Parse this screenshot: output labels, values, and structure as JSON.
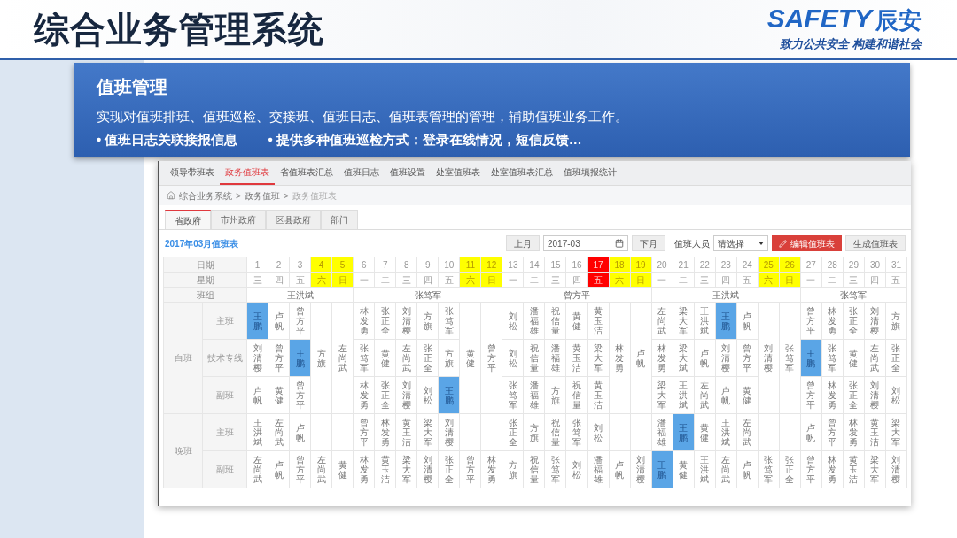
{
  "slide": {
    "title": "综合业务管理系统",
    "logo": {
      "wordmark": "SAFETY",
      "name": "辰安",
      "slogan": "致力公共安全 构建和谐社会"
    }
  },
  "intro": {
    "heading": "值班管理",
    "description": "实现对值班排班、值班巡检、交接班、值班日志、值班表管理的管理，辅助值班业务工作。",
    "bullets": [
      "• 值班日志关联接报信息",
      "• 提供多种值班巡检方式：登录在线情况，短信反馈…"
    ]
  },
  "app": {
    "nav_tabs": [
      {
        "label": "领导带班表",
        "selected": false
      },
      {
        "label": "政务值班表",
        "selected": true
      },
      {
        "label": "省值班表汇总",
        "selected": false
      },
      {
        "label": "值班日志",
        "selected": false
      },
      {
        "label": "值班设置",
        "selected": false
      },
      {
        "label": "处室值班表",
        "selected": false
      },
      {
        "label": "处室值班表汇总",
        "selected": false
      },
      {
        "label": "值班填报统计",
        "selected": false
      }
    ],
    "breadcrumb": [
      "综合业务系统",
      "政务值班",
      "政务值班表"
    ],
    "breadcrumb_separator": ">",
    "sub_tabs": [
      {
        "label": "省政府",
        "selected": true
      },
      {
        "label": "市州政府",
        "selected": false
      },
      {
        "label": "区县政府",
        "selected": false
      },
      {
        "label": "部门",
        "selected": false
      }
    ],
    "table_title": "2017年03月值班表",
    "toolbar": {
      "prev": "上月",
      "month": "2017-03",
      "next": "下月",
      "staff_label": "值班人员",
      "staff_select": "请选择",
      "edit_button": "编辑值班表",
      "generate_button": "生成值班表"
    },
    "schedule": {
      "date_label": "日期",
      "weekday_label": "星期",
      "team_label": "班组",
      "teams": [
        {
          "name": "王洪斌",
          "days": [
            {
              "date": "1",
              "weekday": "三",
              "kind": "workday"
            },
            {
              "date": "2",
              "weekday": "四",
              "kind": "workday"
            },
            {
              "date": "3",
              "weekday": "五",
              "kind": "workday"
            },
            {
              "date": "4",
              "weekday": "六",
              "kind": "weekend"
            },
            {
              "date": "5",
              "weekday": "日",
              "kind": "weekend"
            }
          ]
        },
        {
          "name": "张笃军",
          "days": [
            {
              "date": "6",
              "weekday": "一",
              "kind": "workday"
            },
            {
              "date": "7",
              "weekday": "二",
              "kind": "workday"
            },
            {
              "date": "8",
              "weekday": "三",
              "kind": "workday"
            },
            {
              "date": "9",
              "weekday": "四",
              "kind": "workday"
            },
            {
              "date": "10",
              "weekday": "五",
              "kind": "workday"
            },
            {
              "date": "11",
              "weekday": "六",
              "kind": "weekend"
            },
            {
              "date": "12",
              "weekday": "日",
              "kind": "weekend"
            }
          ]
        },
        {
          "name": "曾方平",
          "days": [
            {
              "date": "13",
              "weekday": "一",
              "kind": "workday"
            },
            {
              "date": "14",
              "weekday": "二",
              "kind": "workday"
            },
            {
              "date": "15",
              "weekday": "三",
              "kind": "workday"
            },
            {
              "date": "16",
              "weekday": "四",
              "kind": "workday"
            },
            {
              "date": "17",
              "weekday": "五",
              "kind": "holiday"
            },
            {
              "date": "18",
              "weekday": "六",
              "kind": "weekend"
            },
            {
              "date": "19",
              "weekday": "日",
              "kind": "weekend"
            }
          ]
        },
        {
          "name": "王洪斌",
          "days": [
            {
              "date": "20",
              "weekday": "一",
              "kind": "workday"
            },
            {
              "date": "21",
              "weekday": "二",
              "kind": "workday"
            },
            {
              "date": "22",
              "weekday": "三",
              "kind": "workday"
            },
            {
              "date": "23",
              "weekday": "四",
              "kind": "workday"
            },
            {
              "date": "24",
              "weekday": "五",
              "kind": "workday"
            },
            {
              "date": "25",
              "weekday": "六",
              "kind": "weekend"
            },
            {
              "date": "26",
              "weekday": "日",
              "kind": "weekend"
            }
          ]
        },
        {
          "name": "张笃军",
          "days": [
            {
              "date": "27",
              "weekday": "一",
              "kind": "workday"
            },
            {
              "date": "28",
              "weekday": "二",
              "kind": "workday"
            },
            {
              "date": "29",
              "weekday": "三",
              "kind": "workday"
            },
            {
              "date": "30",
              "weekday": "四",
              "kind": "workday"
            },
            {
              "date": "31",
              "weekday": "五",
              "kind": "workday"
            }
          ]
        }
      ],
      "shifts": [
        {
          "name": "白班",
          "roles": [
            {
              "name": "主班",
              "cells": [
                {
                  "kind": "single",
                  "name": "王鹏",
                  "highlighted": true
                },
                {
                  "kind": "single",
                  "name": "卢帆",
                  "highlighted": false
                },
                {
                  "kind": "single",
                  "name": "曾方平",
                  "highlighted": false
                },
                {
                  "kind": "merged",
                  "name": "方旗",
                  "highlighted": false
                },
                {
                  "kind": "merged",
                  "name": "左尚武",
                  "highlighted": false
                },
                {
                  "kind": "single",
                  "name": "林发勇",
                  "highlighted": false
                },
                {
                  "kind": "single",
                  "name": "张正全",
                  "highlighted": false
                },
                {
                  "kind": "single",
                  "name": "刘清樱",
                  "highlighted": false
                },
                {
                  "kind": "single",
                  "name": "方旗",
                  "highlighted": false
                },
                {
                  "kind": "single",
                  "name": "张笃军",
                  "highlighted": false
                },
                {
                  "kind": "merged",
                  "name": "黄健",
                  "highlighted": false
                },
                {
                  "kind": "merged",
                  "name": "曾方平",
                  "highlighted": false
                },
                {
                  "kind": "single",
                  "name": "刘松",
                  "highlighted": false
                },
                {
                  "kind": "single",
                  "name": "潘福雄",
                  "highlighted": false
                },
                {
                  "kind": "single",
                  "name": "祝信量",
                  "highlighted": false
                },
                {
                  "kind": "single",
                  "name": "黄健",
                  "highlighted": false
                },
                {
                  "kind": "single",
                  "name": "黄玉洁",
                  "highlighted": false
                },
                {
                  "kind": "merged",
                  "name": "林发勇",
                  "highlighted": false
                },
                {
                  "kind": "merged",
                  "name": "卢帆",
                  "highlighted": false
                },
                {
                  "kind": "single",
                  "name": "左尚武",
                  "highlighted": false
                },
                {
                  "kind": "single",
                  "name": "梁大军",
                  "highlighted": false
                },
                {
                  "kind": "single",
                  "name": "王洪斌",
                  "highlighted": false
                },
                {
                  "kind": "single",
                  "name": "王鹏",
                  "highlighted": true
                },
                {
                  "kind": "single",
                  "name": "卢帆",
                  "highlighted": false
                },
                {
                  "kind": "merged",
                  "name": "刘清樱",
                  "highlighted": false
                },
                {
                  "kind": "merged",
                  "name": "张笃军",
                  "highlighted": false
                },
                {
                  "kind": "single",
                  "name": "曾方平",
                  "highlighted": false
                },
                {
                  "kind": "single",
                  "name": "林发勇",
                  "highlighted": false
                },
                {
                  "kind": "single",
                  "name": "张正全",
                  "highlighted": false
                },
                {
                  "kind": "single",
                  "name": "刘清樱",
                  "highlighted": false
                },
                {
                  "kind": "single",
                  "name": "方旗",
                  "highlighted": false
                }
              ]
            },
            {
              "name": "技术专线",
              "cells": [
                {
                  "kind": "single",
                  "name": "刘清樱",
                  "highlighted": false
                },
                {
                  "kind": "single",
                  "name": "曾方平",
                  "highlighted": false
                },
                {
                  "kind": "single",
                  "name": "王鹏",
                  "highlighted": true
                },
                {
                  "kind": "single",
                  "name": "张笃军",
                  "highlighted": false
                },
                {
                  "kind": "single",
                  "name": "黄健",
                  "highlighted": false
                },
                {
                  "kind": "single",
                  "name": "左尚武",
                  "highlighted": false
                },
                {
                  "kind": "single",
                  "name": "张正全",
                  "highlighted": false
                },
                {
                  "kind": "single",
                  "name": "方旗",
                  "highlighted": false
                },
                {
                  "kind": "single",
                  "name": "刘松",
                  "highlighted": false
                },
                {
                  "kind": "single",
                  "name": "祝信量",
                  "highlighted": false
                },
                {
                  "kind": "single",
                  "name": "潘福雄",
                  "highlighted": false
                },
                {
                  "kind": "single",
                  "name": "黄玉洁",
                  "highlighted": false
                },
                {
                  "kind": "single",
                  "name": "梁大军",
                  "highlighted": false
                },
                {
                  "kind": "single",
                  "name": "林发勇",
                  "highlighted": false
                },
                {
                  "kind": "single",
                  "name": "梁大斌",
                  "highlighted": false
                },
                {
                  "kind": "single",
                  "name": "卢帆",
                  "highlighted": false
                },
                {
                  "kind": "single",
                  "name": "刘清樱",
                  "highlighted": false
                },
                {
                  "kind": "single",
                  "name": "曾方平",
                  "highlighted": false
                },
                {
                  "kind": "single",
                  "name": "王鹏",
                  "highlighted": true
                },
                {
                  "kind": "single",
                  "name": "张笃军",
                  "highlighted": false
                },
                {
                  "kind": "single",
                  "name": "黄健",
                  "highlighted": false
                },
                {
                  "kind": "single",
                  "name": "左尚武",
                  "highlighted": false
                },
                {
                  "kind": "single",
                  "name": "张正全",
                  "highlighted": false
                }
              ]
            },
            {
              "name": "副班",
              "cells": [
                {
                  "kind": "single",
                  "name": "卢帆",
                  "highlighted": false
                },
                {
                  "kind": "single",
                  "name": "黄健",
                  "highlighted": false
                },
                {
                  "kind": "single",
                  "name": "曾方平",
                  "highlighted": false
                },
                {
                  "kind": "single",
                  "name": "林发勇",
                  "highlighted": false
                },
                {
                  "kind": "single",
                  "name": "张正全",
                  "highlighted": false
                },
                {
                  "kind": "single",
                  "name": "刘清樱",
                  "highlighted": false
                },
                {
                  "kind": "single",
                  "name": "刘松",
                  "highlighted": false
                },
                {
                  "kind": "single",
                  "name": "王鹏",
                  "highlighted": true
                },
                {
                  "kind": "single",
                  "name": "张笃军",
                  "highlighted": false
                },
                {
                  "kind": "single",
                  "name": "潘福雄",
                  "highlighted": false
                },
                {
                  "kind": "single",
                  "name": "方旗",
                  "highlighted": false
                },
                {
                  "kind": "single",
                  "name": "祝信量",
                  "highlighted": false
                },
                {
                  "kind": "single",
                  "name": "黄玉洁",
                  "highlighted": false
                },
                {
                  "kind": "single",
                  "name": "梁大军",
                  "highlighted": false
                },
                {
                  "kind": "single",
                  "name": "王洪斌",
                  "highlighted": false
                },
                {
                  "kind": "single",
                  "name": "左尚武",
                  "highlighted": false
                },
                {
                  "kind": "single",
                  "name": "卢帆",
                  "highlighted": false
                },
                {
                  "kind": "single",
                  "name": "黄健",
                  "highlighted": false
                },
                {
                  "kind": "single",
                  "name": "曾方平",
                  "highlighted": false
                },
                {
                  "kind": "single",
                  "name": "林发勇",
                  "highlighted": false
                },
                {
                  "kind": "single",
                  "name": "张正全",
                  "highlighted": false
                },
                {
                  "kind": "single",
                  "name": "刘清樱",
                  "highlighted": false
                },
                {
                  "kind": "single",
                  "name": "刘松",
                  "highlighted": false
                }
              ]
            }
          ]
        },
        {
          "name": "晚班",
          "roles": [
            {
              "name": "主班",
              "cells": [
                {
                  "kind": "single",
                  "name": "王洪斌",
                  "highlighted": false
                },
                {
                  "kind": "single",
                  "name": "左尚武",
                  "highlighted": false
                },
                {
                  "kind": "single",
                  "name": "卢帆",
                  "highlighted": false
                },
                {
                  "kind": "empty"
                },
                {
                  "kind": "empty"
                },
                {
                  "kind": "single",
                  "name": "曾方平",
                  "highlighted": false
                },
                {
                  "kind": "single",
                  "name": "林发勇",
                  "highlighted": false
                },
                {
                  "kind": "single",
                  "name": "黄玉洁",
                  "highlighted": false
                },
                {
                  "kind": "single",
                  "name": "梁大军",
                  "highlighted": false
                },
                {
                  "kind": "single",
                  "name": "刘清樱",
                  "highlighted": false
                },
                {
                  "kind": "empty"
                },
                {
                  "kind": "empty"
                },
                {
                  "kind": "single",
                  "name": "张正全",
                  "highlighted": false
                },
                {
                  "kind": "single",
                  "name": "方旗",
                  "highlighted": false
                },
                {
                  "kind": "single",
                  "name": "祝信量",
                  "highlighted": false
                },
                {
                  "kind": "single",
                  "name": "张笃军",
                  "highlighted": false
                },
                {
                  "kind": "single",
                  "name": "刘松",
                  "highlighted": false
                },
                {
                  "kind": "empty"
                },
                {
                  "kind": "empty"
                },
                {
                  "kind": "single",
                  "name": "潘福雄",
                  "highlighted": false
                },
                {
                  "kind": "single",
                  "name": "王鹏",
                  "highlighted": true
                },
                {
                  "kind": "single",
                  "name": "黄健",
                  "highlighted": false
                },
                {
                  "kind": "single",
                  "name": "王洪斌",
                  "highlighted": false
                },
                {
                  "kind": "single",
                  "name": "左尚武",
                  "highlighted": false
                },
                {
                  "kind": "empty"
                },
                {
                  "kind": "empty"
                },
                {
                  "kind": "single",
                  "name": "卢帆",
                  "highlighted": false
                },
                {
                  "kind": "single",
                  "name": "曾方平",
                  "highlighted": false
                },
                {
                  "kind": "single",
                  "name": "林发勇",
                  "highlighted": false
                },
                {
                  "kind": "single",
                  "name": "黄玉洁",
                  "highlighted": false
                },
                {
                  "kind": "single",
                  "name": "梁大军",
                  "highlighted": false
                }
              ]
            },
            {
              "name": "副班",
              "cells": [
                {
                  "kind": "single",
                  "name": "左尚武",
                  "highlighted": false
                },
                {
                  "kind": "single",
                  "name": "卢帆",
                  "highlighted": false
                },
                {
                  "kind": "single",
                  "name": "曾方平",
                  "highlighted": false
                },
                {
                  "kind": "single",
                  "name": "左尚武",
                  "highlighted": false
                },
                {
                  "kind": "single",
                  "name": "黄健",
                  "highlighted": false
                },
                {
                  "kind": "single",
                  "name": "林发勇",
                  "highlighted": false
                },
                {
                  "kind": "single",
                  "name": "黄玉洁",
                  "highlighted": false
                },
                {
                  "kind": "single",
                  "name": "梁大军",
                  "highlighted": false
                },
                {
                  "kind": "single",
                  "name": "刘清樱",
                  "highlighted": false
                },
                {
                  "kind": "single",
                  "name": "张正全",
                  "highlighted": false
                },
                {
                  "kind": "single",
                  "name": "曾方平",
                  "highlighted": false
                },
                {
                  "kind": "single",
                  "name": "林发勇",
                  "highlighted": false
                },
                {
                  "kind": "single",
                  "name": "方旗",
                  "highlighted": false
                },
                {
                  "kind": "single",
                  "name": "祝信量",
                  "highlighted": false
                },
                {
                  "kind": "single",
                  "name": "张笃军",
                  "highlighted": false
                },
                {
                  "kind": "single",
                  "name": "刘松",
                  "highlighted": false
                },
                {
                  "kind": "single",
                  "name": "潘福雄",
                  "highlighted": false
                },
                {
                  "kind": "single",
                  "name": "卢帆",
                  "highlighted": false
                },
                {
                  "kind": "single",
                  "name": "刘清樱",
                  "highlighted": false
                },
                {
                  "kind": "single",
                  "name": "王鹏",
                  "highlighted": true
                },
                {
                  "kind": "single",
                  "name": "黄健",
                  "highlighted": false
                },
                {
                  "kind": "single",
                  "name": "王洪斌",
                  "highlighted": false
                },
                {
                  "kind": "single",
                  "name": "左尚武",
                  "highlighted": false
                },
                {
                  "kind": "single",
                  "name": "卢帆",
                  "highlighted": false
                },
                {
                  "kind": "single",
                  "name": "张笃军",
                  "highlighted": false
                },
                {
                  "kind": "single",
                  "name": "张正全",
                  "highlighted": false
                },
                {
                  "kind": "single",
                  "name": "曾方平",
                  "highlighted": false
                },
                {
                  "kind": "single",
                  "name": "林发勇",
                  "highlighted": false
                },
                {
                  "kind": "single",
                  "name": "黄玉洁",
                  "highlighted": false
                },
                {
                  "kind": "single",
                  "name": "梁大军",
                  "highlighted": false
                },
                {
                  "kind": "single",
                  "name": "刘清樱",
                  "highlighted": false
                }
              ]
            }
          ]
        }
      ]
    }
  }
}
